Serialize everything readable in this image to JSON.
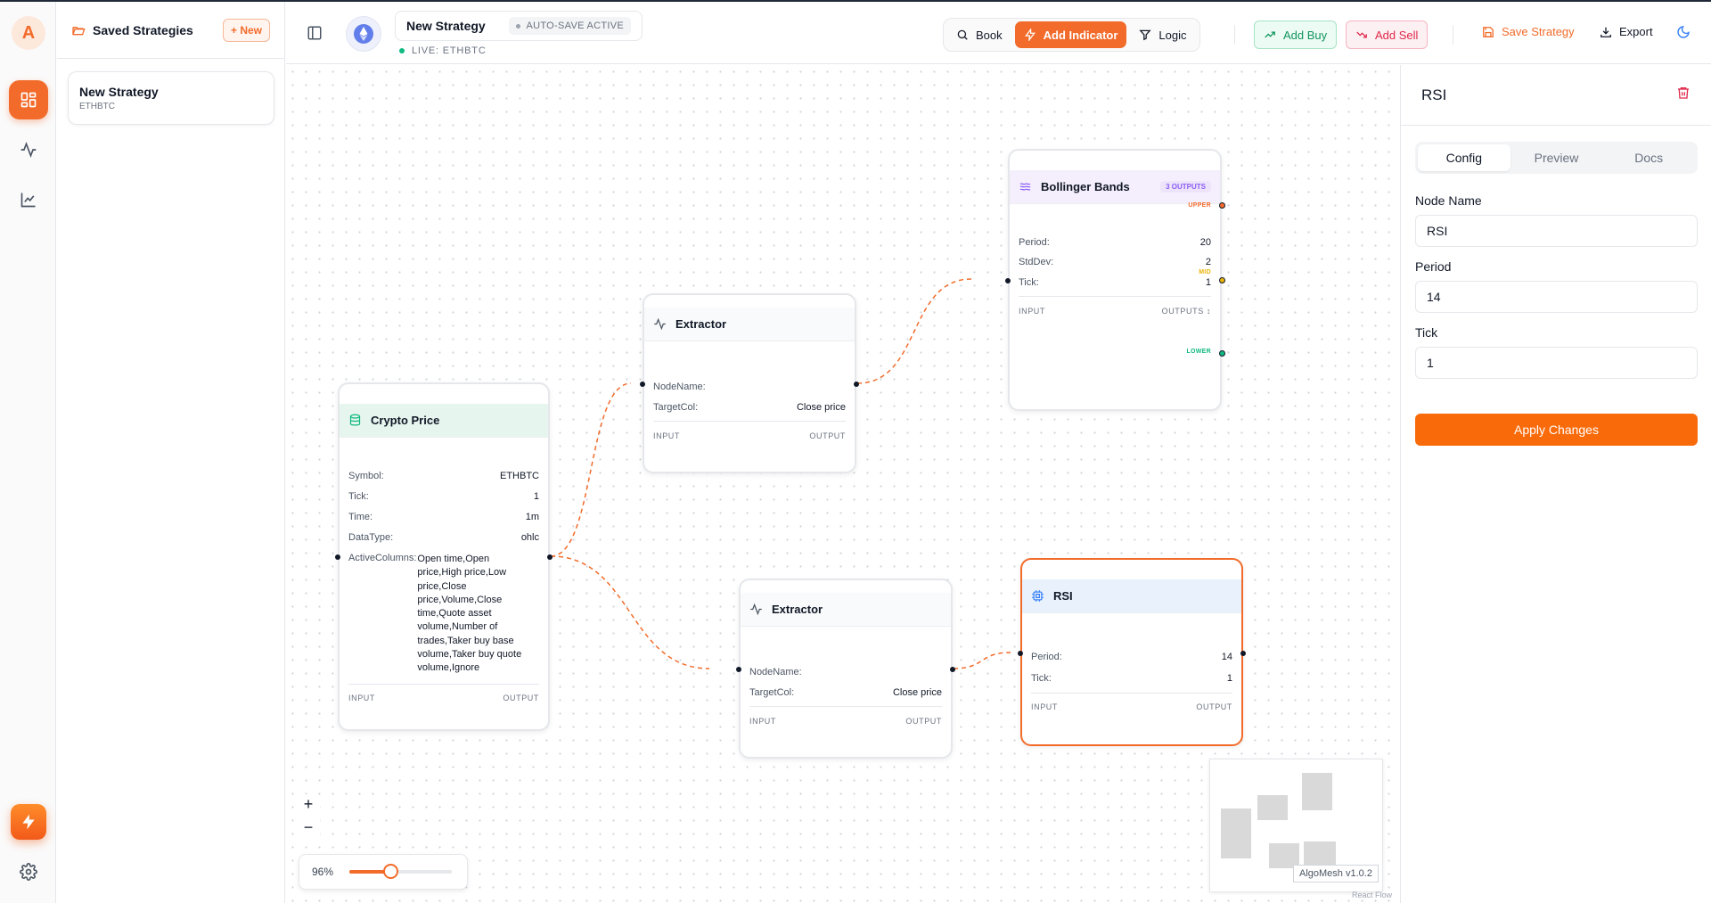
{
  "app": {
    "logo_letter": "A"
  },
  "saved": {
    "title": "Saved Strategies",
    "new_label": "+ New",
    "strategies": [
      {
        "name": "New Strategy",
        "symbol": "ETHBTC"
      }
    ]
  },
  "header": {
    "strategy_name": "New Strategy",
    "autosave": "AUTO-SAVE ACTIVE",
    "live": "LIVE: ETHBTC",
    "book": "Book",
    "add_indicator": "Add Indicator",
    "logic": "Logic",
    "add_buy": "Add Buy",
    "add_sell": "Add Sell",
    "save": "Save Strategy",
    "export": "Export"
  },
  "colors": {
    "accent": "#f26b2a",
    "buy": "#11955d",
    "sell": "#e0284a",
    "selected_border": "#f26b2a"
  },
  "nodes": {
    "crypto": {
      "title": "Crypto Price",
      "rows": {
        "symbol_k": "Symbol:",
        "symbol_v": "ETHBTC",
        "tick_k": "Tick:",
        "tick_v": "1",
        "time_k": "Time:",
        "time_v": "1m",
        "dtype_k": "DataType:",
        "dtype_v": "ohlc",
        "cols_k": "ActiveColumns:"
      },
      "active_columns_lines": [
        "Open time,Open",
        "price,High price,Low",
        "price,Close",
        "price,Volume,Close",
        "time,Quote asset",
        "volume,Number of",
        "trades,Taker buy base",
        "volume,Taker buy quote",
        "volume,Ignore"
      ],
      "input": "INPUT",
      "output": "OUTPUT"
    },
    "extractor1": {
      "title": "Extractor",
      "nodename_k": "NodeName:",
      "nodename_v": "",
      "target_k": "TargetCol:",
      "target_v": "Close price",
      "input": "INPUT",
      "output": "OUTPUT"
    },
    "extractor2": {
      "title": "Extractor",
      "nodename_k": "NodeName:",
      "nodename_v": "",
      "target_k": "TargetCol:",
      "target_v": "Close price",
      "input": "INPUT",
      "output": "OUTPUT"
    },
    "bollinger": {
      "title": "Bollinger Bands",
      "badge": "3 OUTPUTS",
      "period_k": "Period:",
      "period_v": "20",
      "stddev_k": "StdDev:",
      "stddev_v": "2",
      "tick_k": "Tick:",
      "tick_v": "1",
      "input": "INPUT",
      "outputs": "OUTPUTS ↕",
      "upper": "UPPER",
      "mid": "MID",
      "lower": "LOWER"
    },
    "rsi": {
      "title": "RSI",
      "period_k": "Period:",
      "period_v": "14",
      "tick_k": "Tick:",
      "tick_v": "1",
      "input": "INPUT",
      "output": "OUTPUT"
    }
  },
  "canvas": {
    "zoom_label": "96%",
    "zoom_fraction": 0.4,
    "version": "AlgoMesh v1.0.2",
    "attribution": "React Flow",
    "zoom_in": "+",
    "zoom_out": "−"
  },
  "panel": {
    "title": "RSI",
    "tabs": [
      "Config",
      "Preview",
      "Docs"
    ],
    "fields": {
      "node_name_label": "Node Name",
      "node_name_value": "RSI",
      "period_label": "Period",
      "period_value": "14",
      "tick_label": "Tick",
      "tick_value": "1"
    },
    "apply": "Apply Changes"
  }
}
